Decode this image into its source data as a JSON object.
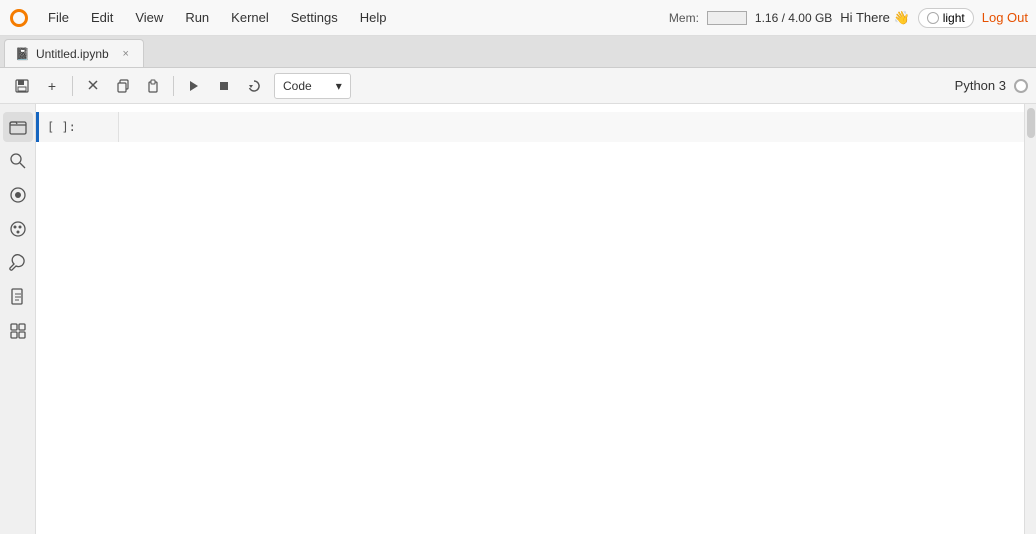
{
  "topbar": {
    "menu": [
      "File",
      "Edit",
      "View",
      "Run",
      "Kernel",
      "Settings",
      "Help"
    ],
    "mem_label": "Mem:",
    "mem_value": "1.16 / 4.00 GB",
    "greeting": "Hi There 👋",
    "theme_label": "light",
    "logout_label": "Log Out"
  },
  "tab": {
    "icon": "📓",
    "name": "Untitled.ipynb",
    "close": "×"
  },
  "toolbar": {
    "save_icon": "💾",
    "add_icon": "+",
    "cut_icon": "✂",
    "copy_icon": "⊡",
    "paste_icon": "⊟",
    "run_icon": "▶",
    "stop_icon": "■",
    "restart_icon": "↺",
    "cell_type": "Code",
    "chevron": "▾",
    "kernel_name": "Python 3"
  },
  "sidebar": {
    "icons": [
      {
        "name": "folder-icon",
        "glyph": "📁"
      },
      {
        "name": "search-icon",
        "glyph": "🔍"
      },
      {
        "name": "circle-icon",
        "glyph": "⬤"
      },
      {
        "name": "palette-icon",
        "glyph": "🎨"
      },
      {
        "name": "tool-icon",
        "glyph": "🔧"
      },
      {
        "name": "file-icon",
        "glyph": "📄"
      },
      {
        "name": "puzzle-icon",
        "glyph": "🧩"
      }
    ]
  },
  "cell": {
    "prompt": "[ ]:",
    "content": ""
  }
}
